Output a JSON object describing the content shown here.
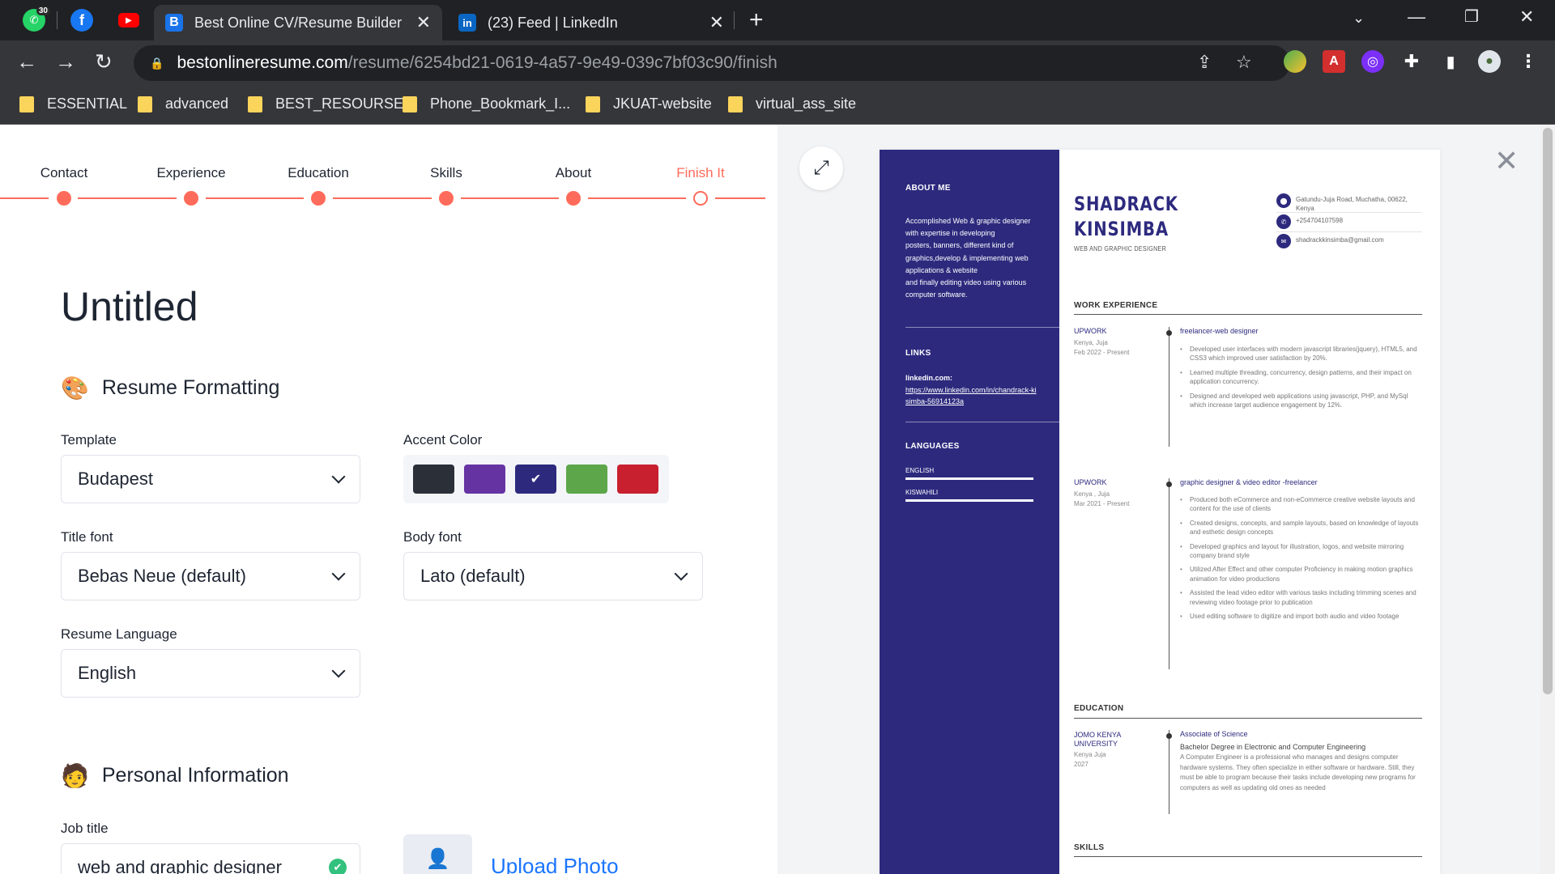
{
  "browser": {
    "pinned": [
      {
        "name": "WhatsApp",
        "badge": "30"
      },
      {
        "name": "Facebook",
        "glyph": "f"
      },
      {
        "name": "YouTube",
        "glyph": "▶"
      }
    ],
    "tabs": [
      {
        "favicon": "B",
        "favicon_color": "#1a73e8",
        "title": "Best Online CV/Resume Builder -",
        "active": true
      },
      {
        "favicon": "in",
        "favicon_color": "#0a66c2",
        "title": "(23) Feed | LinkedIn",
        "active": false
      }
    ],
    "url_host": "bestonlineresume.com",
    "url_path": "/resume/6254bd21-0619-4a57-9e49-039c7bf03c90/finish",
    "bookmarks": [
      "ESSENTIAL",
      "advanced",
      "BEST_RESOURSE",
      "Phone_Bookmark_I...",
      "JKUAT-website",
      "virtual_ass_site"
    ]
  },
  "stepper": {
    "steps": [
      "Contact",
      "Experience",
      "Education",
      "Skills",
      "About",
      "Finish It"
    ],
    "current_step": "Finish It"
  },
  "editor": {
    "title": "Untitled",
    "formatting_heading": "Resume Formatting",
    "formatting_emoji": "🎨",
    "template_label": "Template",
    "template_value": "Budapest",
    "accent_label": "Accent Color",
    "accent_colors": [
      "#2b2f38",
      "#6633a3",
      "#2d2a7e",
      "#5da74a",
      "#c8202f"
    ],
    "accent_selected": "#2d2a7e",
    "title_font_label": "Title font",
    "title_font_value": "Bebas Neue (default)",
    "body_font_label": "Body font",
    "body_font_value": "Lato (default)",
    "language_label": "Resume Language",
    "language_value": "English",
    "personal_heading": "Personal Information",
    "personal_emoji": "🧑",
    "job_title_label": "Job title",
    "job_title_value": "web and graphic designer",
    "upload_photo": "Upload Photo"
  },
  "resume": {
    "name_line1": "SHADRACK",
    "name_line2": "KINSIMBA",
    "role": "WEB AND GRAPHIC DESIGNER",
    "address": "Gatundu-Juja Road, Muchatha, 00622, Kenya",
    "phone": "+254704107598",
    "email": "shadrackkinsimba@gmail.com",
    "about_heading": "ABOUT ME",
    "about_text": "Accomplished Web & graphic designer with expertise in developing\nposters, banners, different kind of graphics,develop & implementing web applications & website\nand finally editing video using various computer software.",
    "links_heading": "LINKS",
    "link_label": "linkedin.com:",
    "link_url": "https://www.linkedin.com/in/chandrack-kisimba-56914123a",
    "languages_heading": "LANGUAGES",
    "languages": [
      "ENGLISH",
      "KISWAHILI"
    ],
    "work_heading": "WORK EXPERIENCE",
    "jobs": [
      {
        "company": "UPWORK",
        "location": "Kenya, Juja",
        "dates": "Feb 2022 - Present",
        "position": "freelancer-web designer",
        "bullets": [
          "Developed user interfaces with modern javascript libraries(jquery), HTML5, and CSS3 which improved user satisfaction by 20%.",
          "Learned multiple threading, concurrency, design patterns, and their impact on application concurrency.",
          "Designed and developed web applications using javascript, PHP, and MySql which increase target audience engagement by 12%."
        ]
      },
      {
        "company": "UPWORK",
        "location": "Kenya , Juja",
        "dates": "Mar 2021 - Present",
        "position": "graphic designer & video editor -freelancer",
        "bullets": [
          "Produced both eCommerce and non-eCommerce creative website layouts and content for the use of clients",
          "Created designs, concepts, and sample layouts, based on knowledge of layouts and esthetic design concepts",
          "Developed graphics and layout for illustration, logos, and website mirroring company brand style",
          "Utilized After Effect and other computer Proficiency in making motion graphics animation for video productions",
          "Assisted the lead video editor with various tasks including trimming scenes and reviewing video footage prior to publication",
          "Used editing software to digitize and import both audio and video footage"
        ]
      }
    ],
    "education_heading": "EDUCATION",
    "education": {
      "school": "JOMO KENYA UNIVERSITY",
      "location": "Kenya Juja",
      "year": "2027",
      "degree_title": "Associate of Science",
      "degree": "Bachelor Degree in Electronic and Computer Engineering",
      "description": "A Computer Engineer is a professional who manages and designs computer hardware systems. They often specialize in either software or hardware. Still, they must be able to program because their tasks include developing new programs for computers as well as updating old ones as needed"
    },
    "skills_heading": "SKILLS"
  }
}
